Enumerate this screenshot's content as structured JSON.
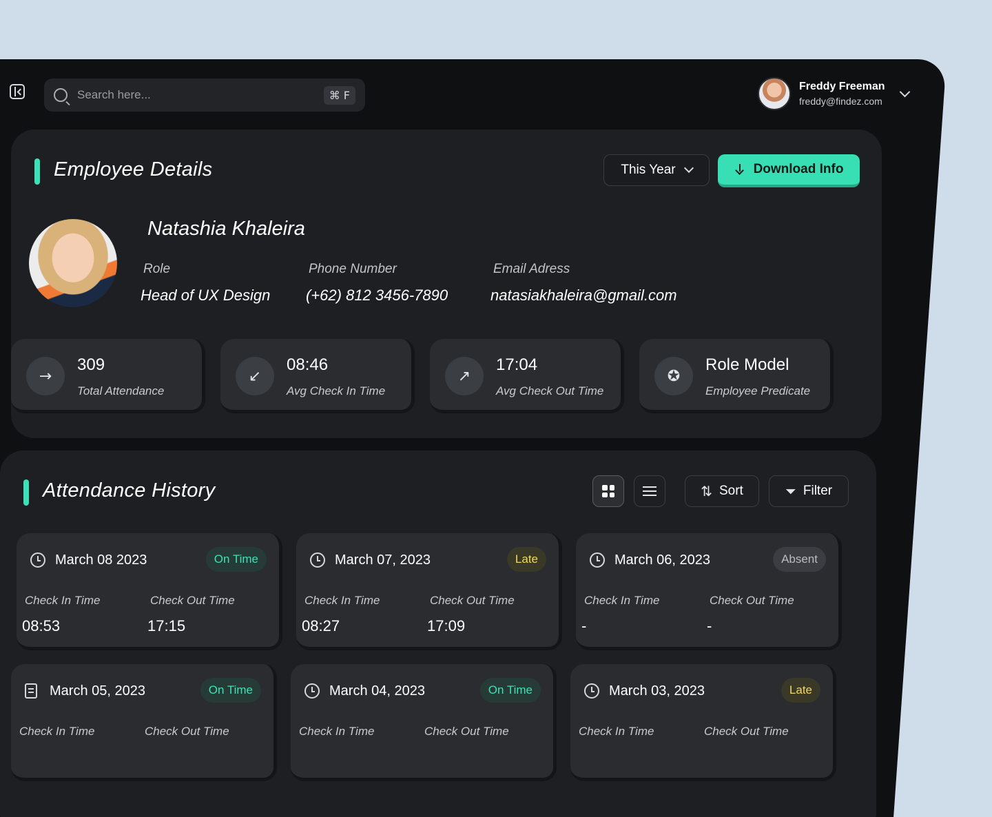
{
  "search": {
    "placeholder": "Search here...",
    "shortcut": "⌘ F"
  },
  "user": {
    "name": "Freddy Freeman",
    "email": "freddy@findez.com"
  },
  "details": {
    "title": "Employee Details",
    "period_label": "This Year",
    "download_label": "Download Info",
    "employee": {
      "name": "Natashia Khaleira",
      "role_label": "Role",
      "role": "Head of UX Design",
      "phone_label": "Phone Number",
      "phone": "(+62) 812 3456-7890",
      "email_label": "Email Adress",
      "email": "natasiakhaleira@gmail.com"
    },
    "stats": [
      {
        "value": "309",
        "label": "Total Attendance",
        "icon": "login-arrow-icon"
      },
      {
        "value": "08:46",
        "label": "Avg Check In Time",
        "icon": "check-in-icon"
      },
      {
        "value": "17:04",
        "label": "Avg Check Out Time",
        "icon": "check-out-icon"
      },
      {
        "value": "Role Model",
        "label": "Employee Predicate",
        "icon": "award-icon"
      }
    ]
  },
  "history": {
    "title": "Attendance History",
    "sort_label": "Sort",
    "filter_label": "Filter",
    "check_in_label": "Check In Time",
    "check_out_label": "Check Out Time",
    "records": [
      {
        "date": "March 08 2023",
        "status": "On Time",
        "check_in": "08:53",
        "check_out": "17:15"
      },
      {
        "date": "March 07, 2023",
        "status": "Late",
        "check_in": "08:27",
        "check_out": "17:09"
      },
      {
        "date": "March 06, 2023",
        "status": "Absent",
        "check_in": "-",
        "check_out": "-"
      },
      {
        "date": "March 05, 2023",
        "status": "On Time"
      },
      {
        "date": "March 04, 2023",
        "status": "On Time"
      },
      {
        "date": "March 03, 2023",
        "status": "Late"
      }
    ]
  },
  "colors": {
    "accent": "#3de0b7",
    "late": "#f0d95c",
    "background": "#cfdce9",
    "panel": "#1d1f22"
  }
}
